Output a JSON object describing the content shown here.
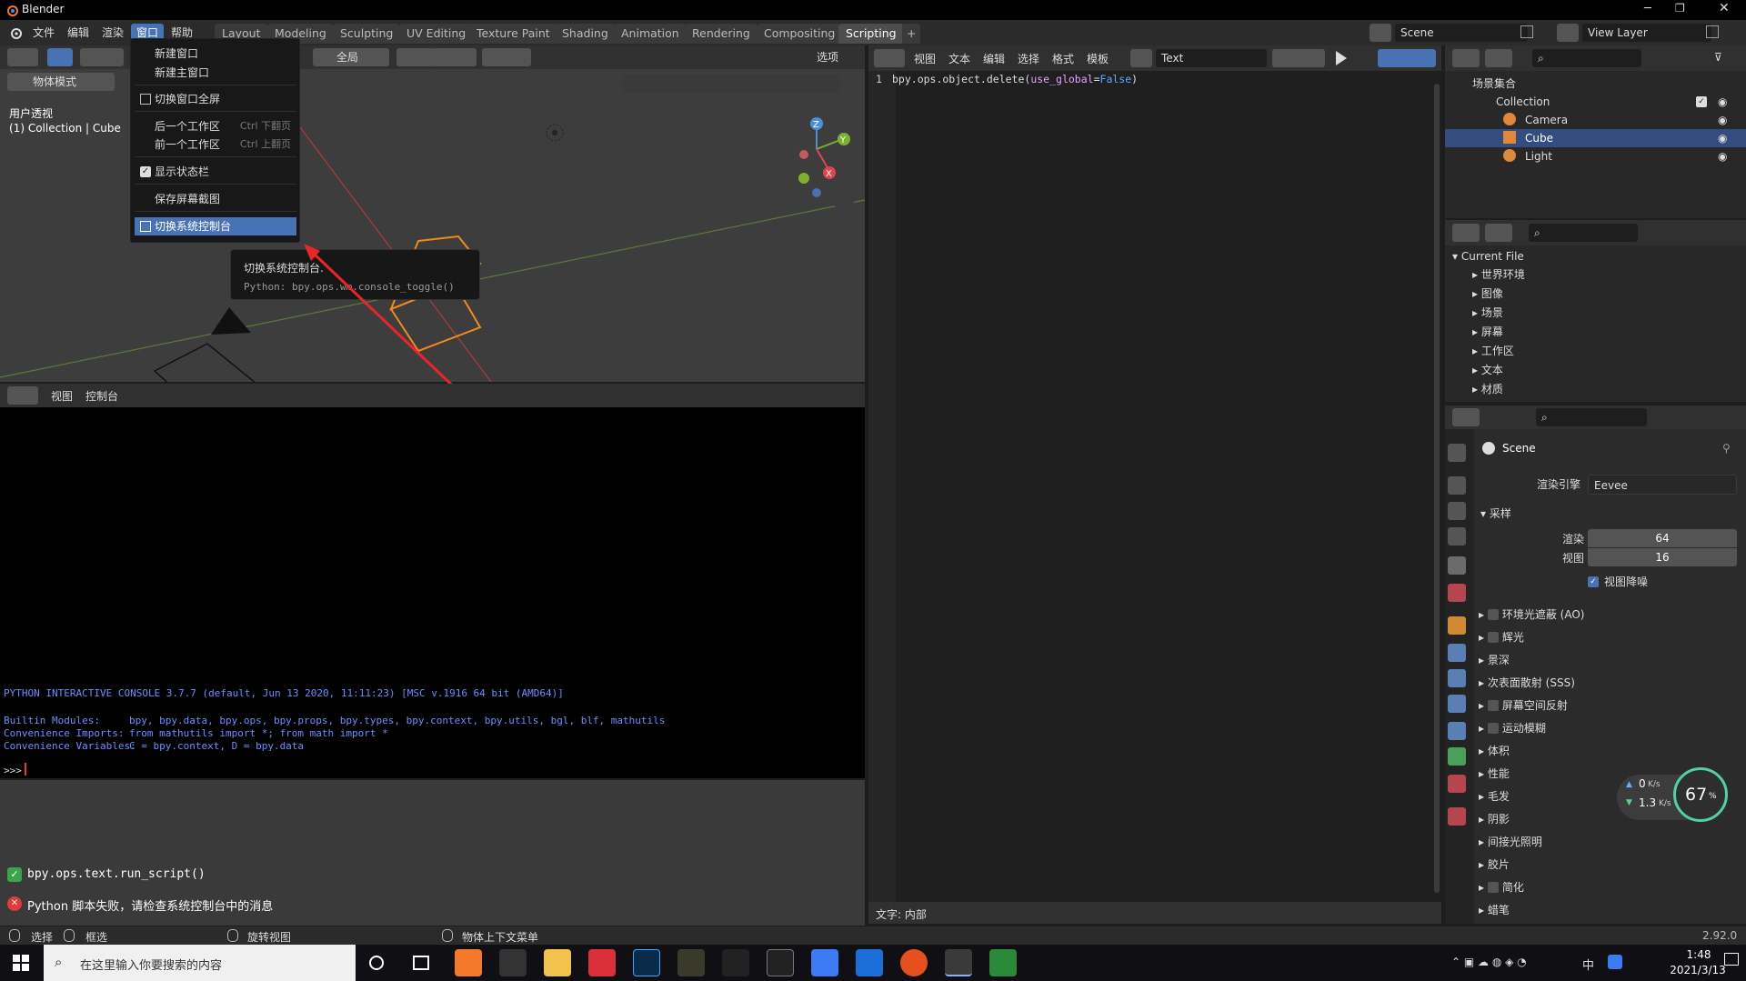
{
  "window": {
    "title": "Blender",
    "icon": "blender-logo-icon"
  },
  "topbar": {
    "menus": [
      "文件",
      "编辑",
      "渲染",
      "窗口",
      "帮助"
    ],
    "active_menu": "窗口",
    "tabs": [
      "Layout",
      "Modeling",
      "Sculpting",
      "UV Editing",
      "Texture Paint",
      "Shading",
      "Animation",
      "Rendering",
      "Compositing",
      "Scripting"
    ],
    "active_tab": "Scripting",
    "add_tab": "+",
    "scene": "Scene",
    "view_layer": "View Layer"
  },
  "window_menu": {
    "items": [
      {
        "label": "新建窗口",
        "shortcut": ""
      },
      {
        "label": "新建主窗口",
        "shortcut": ""
      },
      {
        "label": "切换窗口全屏",
        "shortcut": ""
      },
      {
        "label": "后一个工作区",
        "shortcut": "Ctrl 下翻页"
      },
      {
        "label": "前一个工作区",
        "shortcut": "Ctrl 上翻页"
      },
      {
        "label": "显示状态栏",
        "shortcut": "",
        "checked": true
      },
      {
        "label": "保存屏幕截图",
        "shortcut": ""
      },
      {
        "label": "切换系统控制台",
        "shortcut": "",
        "highlighted": true
      }
    ]
  },
  "tooltip": {
    "title": "切换系统控制台.",
    "python": "Python: bpy.ops.wm.console_toggle()"
  },
  "viewport": {
    "mode": "物体模式",
    "orientation": "全局",
    "options": "选项",
    "view_name": "用户透视",
    "collection_label": "(1) Collection | Cube",
    "gizmo": {
      "z": "Z",
      "y": "Y",
      "x": "X"
    }
  },
  "console": {
    "menus": [
      "视图",
      "控制台"
    ],
    "banner": "PYTHON INTERACTIVE CONSOLE 3.7.7 (default, Jun 13 2020, 11:11:23) [MSC v.1916 64 bit (AMD64)]",
    "modules_label": "Builtin Modules:",
    "modules": "bpy, bpy.data, bpy.ops, bpy.props, bpy.types, bpy.context, bpy.utils, bgl, blf, mathutils",
    "imports_label": "Convenience Imports:",
    "imports": "from mathutils import *; from math import *",
    "vars_label": "Convenience Variables:",
    "vars": "C = bpy.context, D = bpy.data",
    "prompt": ">>> "
  },
  "info": {
    "line1": "bpy.ops.text.run_script()",
    "line2": "Python 脚本失败，请检查系统控制台中的消息"
  },
  "text_editor": {
    "menus": [
      "视图",
      "文本",
      "编辑",
      "选择",
      "格式",
      "模板"
    ],
    "filename": "Text",
    "line_no": "1",
    "code_a": "bpy.ops.object.delete(",
    "code_b": "use_global",
    "code_c": "=",
    "code_d": "False",
    "code_e": ")",
    "footer": "文字: 内部"
  },
  "outliner": {
    "root": "场景集合",
    "collection": "Collection",
    "items": [
      "Camera",
      "Cube",
      "Light"
    ],
    "selected": "Cube"
  },
  "datablocks": {
    "title": "Current File",
    "items": [
      "世界环境",
      "图像",
      "场景",
      "屏幕",
      "工作区",
      "文本",
      "材质"
    ]
  },
  "properties": {
    "scene": "Scene",
    "engine_label": "渲染引擎",
    "engine": "Eevee",
    "sampling": "采样",
    "render_label": "渲染",
    "render_val": "64",
    "viewport_label": "视图",
    "viewport_val": "16",
    "denoise": "视图降噪",
    "panels": [
      {
        "label": "环境光遮蔽 (AO)",
        "cb": true
      },
      {
        "label": "辉光",
        "cb": true
      },
      {
        "label": "景深",
        "cb": false
      },
      {
        "label": "次表面散射 (SSS)",
        "cb": false
      },
      {
        "label": "屏幕空间反射",
        "cb": true
      },
      {
        "label": "运动模糊",
        "cb": true
      },
      {
        "label": "体积",
        "cb": false
      },
      {
        "label": "性能",
        "cb": false
      },
      {
        "label": "毛发",
        "cb": false
      },
      {
        "label": "阴影",
        "cb": false
      },
      {
        "label": "间接光照明",
        "cb": false
      },
      {
        "label": "胶片",
        "cb": false
      },
      {
        "label": "简化",
        "cb": true
      },
      {
        "label": "蜡笔",
        "cb": false
      }
    ]
  },
  "net_widget": {
    "up": "0",
    "up_unit": "K/s",
    "down": "1.3",
    "down_unit": "K/s",
    "percent": "67",
    "pct_sign": "%"
  },
  "statusbar": {
    "select": "选择",
    "box": "框选",
    "rotate": "旋转视图",
    "context_menu": "物体上下文菜单",
    "version": "2.92.0"
  },
  "taskbar": {
    "search_placeholder": "在这里输入你要搜索的内容",
    "time": "1:48",
    "date": "2021/3/13",
    "ime": "中"
  },
  "colors": {
    "accent": "#4772b3",
    "selected_row": "#334d80",
    "error": "#e23a3a",
    "ok": "#3ba34b",
    "console_text": "#6b8fff",
    "arrow": "#e8262a",
    "object_orange": "#f28b1b"
  }
}
